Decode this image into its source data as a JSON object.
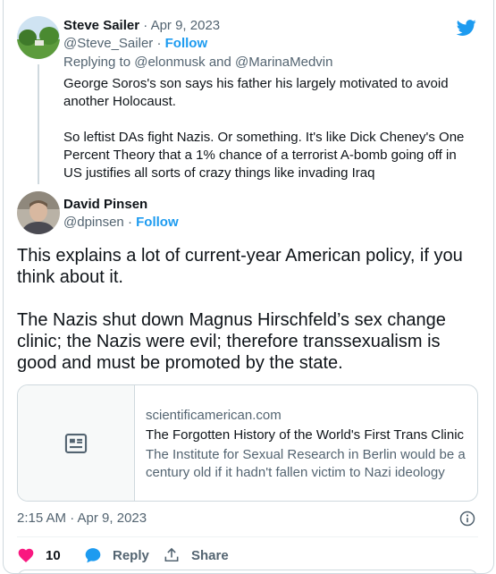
{
  "brand": {
    "icon": "twitter-bird-icon",
    "color": "#1d9bf0"
  },
  "quoted_reply": {
    "author_name": "Steve Sailer",
    "separator": " · ",
    "date": "Apr 9, 2023",
    "handle": "@Steve_Sailer",
    "follow_label": "Follow",
    "replying_prefix": "Replying to",
    "replying_user1": "@elonmusk",
    "replying_and": "and",
    "replying_user2": "@MarinaMedvin",
    "paragraphs": [
      "George Soros's son says his father his largely motivated to avoid another Holocaust.",
      "So leftist DAs fight Nazis. Or something. It's like Dick Cheney's One Percent Theory that a 1% chance of a terrorist A-bomb going off in US justifies all sorts of crazy things like invading Iraq"
    ]
  },
  "main_tweet": {
    "author_name": "David Pinsen",
    "handle": "@dpinsen",
    "separator": " · ",
    "follow_label": "Follow",
    "paragraphs": [
      "This explains a lot of current-year American policy, if you think about it.",
      "The Nazis shut down Magnus Hirschfeld’s sex change clinic; the Nazis were evil; therefore transsexualism is good and must be promoted by the state."
    ],
    "link_card": {
      "icon": "article-icon",
      "domain": "scientificamerican.com",
      "title": "The Forgotten History of the World's First Trans Clinic",
      "description": "The Institute for Sexual Research in Berlin would be a century old if it hadn't fallen victim to Nazi ideology"
    },
    "timestamp": "2:15 AM · Apr 9, 2023",
    "actions": {
      "like_count": "10",
      "reply_label": "Reply",
      "share_label": "Share"
    }
  },
  "colors": {
    "like": "#f91880",
    "reply": "#1d9bf0",
    "muted": "#536471"
  }
}
